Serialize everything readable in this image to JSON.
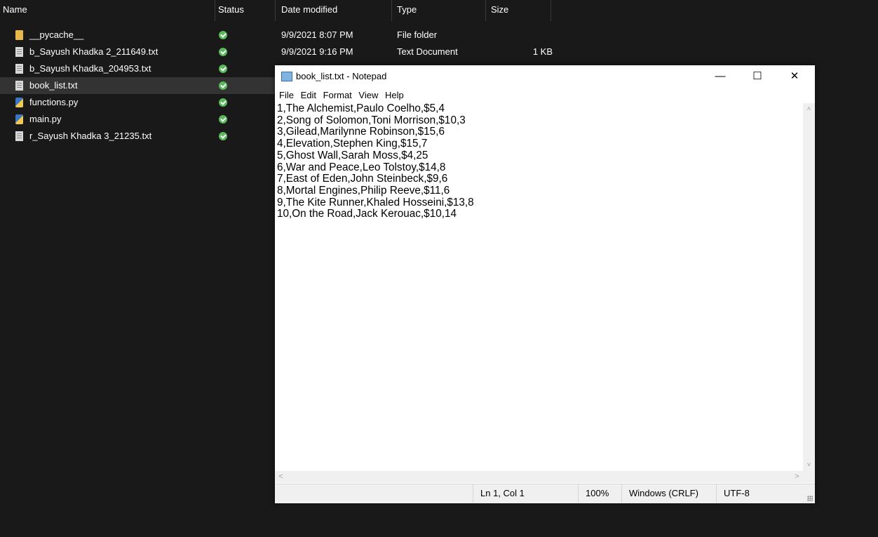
{
  "explorer": {
    "columns": {
      "name": "Name",
      "status": "Status",
      "date": "Date modified",
      "type": "Type",
      "size": "Size"
    },
    "files": [
      {
        "name": "__pycache__",
        "icon": "folder-icon",
        "date": "9/9/2021 8:07 PM",
        "type": "File folder",
        "size": ""
      },
      {
        "name": "b_Sayush Khadka 2_211649.txt",
        "icon": "text-file-icon",
        "date": "9/9/2021 9:16 PM",
        "type": "Text Document",
        "size": "1 KB"
      },
      {
        "name": "b_Sayush Khadka_204953.txt",
        "icon": "text-file-icon",
        "date": "",
        "type": "",
        "size": ""
      },
      {
        "name": "book_list.txt",
        "icon": "text-file-icon",
        "date": "",
        "type": "",
        "size": "",
        "selected": true
      },
      {
        "name": "functions.py",
        "icon": "python-file-icon",
        "date": "",
        "type": "",
        "size": ""
      },
      {
        "name": "main.py",
        "icon": "python-file-icon",
        "date": "",
        "type": "",
        "size": ""
      },
      {
        "name": "r_Sayush Khadka 3_21235.txt",
        "icon": "text-file-icon",
        "date": "",
        "type": "",
        "size": ""
      }
    ]
  },
  "notepad": {
    "title": "book_list.txt - Notepad",
    "controls": {
      "minimize": "—",
      "maximize": "☐",
      "close": "✕"
    },
    "menu": [
      "File",
      "Edit",
      "Format",
      "View",
      "Help"
    ],
    "content": "1,The Alchemist,Paulo Coelho,$5,4\n2,Song of Solomon,Toni Morrison,$10,3\n3,Gilead,Marilynne Robinson,$15,6\n4,Elevation,Stephen King,$15,7\n5,Ghost Wall,Sarah Moss,$4,25\n6,War and Peace,Leo Tolstoy,$14,8\n7,East of Eden,John Steinbeck,$9,6\n8,Mortal Engines,Philip Reeve,$11,6\n9,The Kite Runner,Khaled Hosseini,$13,8\n10,On the Road,Jack Kerouac,$10,14",
    "status": {
      "position": "Ln 1, Col 1",
      "zoom": "100%",
      "line_ending": "Windows (CRLF)",
      "encoding": "UTF-8"
    }
  },
  "colors": {
    "explorer_bg": "#191919",
    "selected_row": "#333333",
    "status_ok": "#5cb85c",
    "notepad_bg": "#ffffff"
  }
}
